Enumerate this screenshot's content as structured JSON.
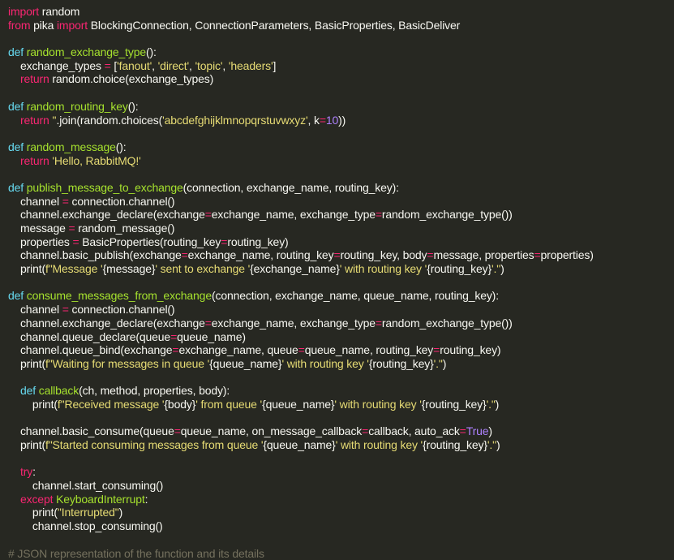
{
  "colors": {
    "background": "#272822",
    "plain": "#f8f8f2",
    "keyword": "#f92672",
    "def": "#66d9ef",
    "function": "#a6e22e",
    "string": "#e6db74",
    "number": "#ae81ff",
    "comment": "#75715e"
  },
  "code_lines": [
    [
      [
        "kw",
        "import"
      ],
      [
        "plain",
        " random"
      ]
    ],
    [
      [
        "kw",
        "from"
      ],
      [
        "plain",
        " pika "
      ],
      [
        "kw",
        "import"
      ],
      [
        "plain",
        " BlockingConnection, ConnectionParameters, BasicProperties, BasicDeliver"
      ]
    ],
    [],
    [
      [
        "def",
        "def"
      ],
      [
        "plain",
        " "
      ],
      [
        "fn",
        "random_exchange_type"
      ],
      [
        "plain",
        "():"
      ]
    ],
    [
      [
        "plain",
        "    exchange_types "
      ],
      [
        "op",
        "="
      ],
      [
        "plain",
        " ["
      ],
      [
        "str",
        "'fanout'"
      ],
      [
        "plain",
        ", "
      ],
      [
        "str",
        "'direct'"
      ],
      [
        "plain",
        ", "
      ],
      [
        "str",
        "'topic'"
      ],
      [
        "plain",
        ", "
      ],
      [
        "str",
        "'headers'"
      ],
      [
        "plain",
        "]"
      ]
    ],
    [
      [
        "plain",
        "    "
      ],
      [
        "kw",
        "return"
      ],
      [
        "plain",
        " random.choice(exchange_types)"
      ]
    ],
    [],
    [
      [
        "def",
        "def"
      ],
      [
        "plain",
        " "
      ],
      [
        "fn",
        "random_routing_key"
      ],
      [
        "plain",
        "():"
      ]
    ],
    [
      [
        "plain",
        "    "
      ],
      [
        "kw",
        "return"
      ],
      [
        "plain",
        " "
      ],
      [
        "str",
        "''"
      ],
      [
        "plain",
        ".join(random.choices("
      ],
      [
        "str",
        "'abcdefghijklmnopqrstuvwxyz'"
      ],
      [
        "plain",
        ", k"
      ],
      [
        "op",
        "="
      ],
      [
        "num",
        "10"
      ],
      [
        "plain",
        "))"
      ]
    ],
    [],
    [
      [
        "def",
        "def"
      ],
      [
        "plain",
        " "
      ],
      [
        "fn",
        "random_message"
      ],
      [
        "plain",
        "():"
      ]
    ],
    [
      [
        "plain",
        "    "
      ],
      [
        "kw",
        "return"
      ],
      [
        "plain",
        " "
      ],
      [
        "str",
        "'Hello, RabbitMQ!'"
      ]
    ],
    [],
    [
      [
        "def",
        "def"
      ],
      [
        "plain",
        " "
      ],
      [
        "fn",
        "publish_message_to_exchange"
      ],
      [
        "plain",
        "(connection, exchange_name, routing_key):"
      ]
    ],
    [
      [
        "plain",
        "    channel "
      ],
      [
        "op",
        "="
      ],
      [
        "plain",
        " connection.channel()"
      ]
    ],
    [
      [
        "plain",
        "    channel.exchange_declare(exchange"
      ],
      [
        "op",
        "="
      ],
      [
        "plain",
        "exchange_name, exchange_type"
      ],
      [
        "op",
        "="
      ],
      [
        "plain",
        "random_exchange_type())"
      ]
    ],
    [
      [
        "plain",
        "    message "
      ],
      [
        "op",
        "="
      ],
      [
        "plain",
        " random_message()"
      ]
    ],
    [
      [
        "plain",
        "    properties "
      ],
      [
        "op",
        "="
      ],
      [
        "plain",
        " BasicProperties(routing_key"
      ],
      [
        "op",
        "="
      ],
      [
        "plain",
        "routing_key)"
      ]
    ],
    [
      [
        "plain",
        "    channel.basic_publish(exchange"
      ],
      [
        "op",
        "="
      ],
      [
        "plain",
        "exchange_name, routing_key"
      ],
      [
        "op",
        "="
      ],
      [
        "plain",
        "routing_key, body"
      ],
      [
        "op",
        "="
      ],
      [
        "plain",
        "message, properties"
      ],
      [
        "op",
        "="
      ],
      [
        "plain",
        "properties)"
      ]
    ],
    [
      [
        "plain",
        "    print("
      ],
      [
        "str",
        "f\"Message '"
      ],
      [
        "plain",
        "{message}"
      ],
      [
        "str",
        "' sent to exchange '"
      ],
      [
        "plain",
        "{exchange_name}"
      ],
      [
        "str",
        "' with routing key '"
      ],
      [
        "plain",
        "{routing_key}"
      ],
      [
        "str",
        "'.\""
      ],
      [
        "plain",
        ")"
      ]
    ],
    [],
    [
      [
        "def",
        "def"
      ],
      [
        "plain",
        " "
      ],
      [
        "fn",
        "consume_messages_from_exchange"
      ],
      [
        "plain",
        "(connection, exchange_name, queue_name, routing_key):"
      ]
    ],
    [
      [
        "plain",
        "    channel "
      ],
      [
        "op",
        "="
      ],
      [
        "plain",
        " connection.channel()"
      ]
    ],
    [
      [
        "plain",
        "    channel.exchange_declare(exchange"
      ],
      [
        "op",
        "="
      ],
      [
        "plain",
        "exchange_name, exchange_type"
      ],
      [
        "op",
        "="
      ],
      [
        "plain",
        "random_exchange_type())"
      ]
    ],
    [
      [
        "plain",
        "    channel.queue_declare(queue"
      ],
      [
        "op",
        "="
      ],
      [
        "plain",
        "queue_name)"
      ]
    ],
    [
      [
        "plain",
        "    channel.queue_bind(exchange"
      ],
      [
        "op",
        "="
      ],
      [
        "plain",
        "exchange_name, queue"
      ],
      [
        "op",
        "="
      ],
      [
        "plain",
        "queue_name, routing_key"
      ],
      [
        "op",
        "="
      ],
      [
        "plain",
        "routing_key)"
      ]
    ],
    [
      [
        "plain",
        "    print("
      ],
      [
        "str",
        "f\"Waiting for messages in queue '"
      ],
      [
        "plain",
        "{queue_name}"
      ],
      [
        "str",
        "' with routing key '"
      ],
      [
        "plain",
        "{routing_key}"
      ],
      [
        "str",
        "'.\""
      ],
      [
        "plain",
        ")"
      ]
    ],
    [],
    [
      [
        "plain",
        "    "
      ],
      [
        "def",
        "def"
      ],
      [
        "plain",
        " "
      ],
      [
        "fn",
        "callback"
      ],
      [
        "plain",
        "(ch, method, properties, body):"
      ]
    ],
    [
      [
        "plain",
        "        print("
      ],
      [
        "str",
        "f\"Received message '"
      ],
      [
        "plain",
        "{body}"
      ],
      [
        "str",
        "' from queue '"
      ],
      [
        "plain",
        "{queue_name}"
      ],
      [
        "str",
        "' with routing key '"
      ],
      [
        "plain",
        "{routing_key}"
      ],
      [
        "str",
        "'.\""
      ],
      [
        "plain",
        ")"
      ]
    ],
    [],
    [
      [
        "plain",
        "    channel.basic_consume(queue"
      ],
      [
        "op",
        "="
      ],
      [
        "plain",
        "queue_name, on_message_callback"
      ],
      [
        "op",
        "="
      ],
      [
        "plain",
        "callback, auto_ack"
      ],
      [
        "op",
        "="
      ],
      [
        "const",
        "True"
      ],
      [
        "plain",
        ")"
      ]
    ],
    [
      [
        "plain",
        "    print("
      ],
      [
        "str",
        "f\"Started consuming messages from queue '"
      ],
      [
        "plain",
        "{queue_name}"
      ],
      [
        "str",
        "' with routing key '"
      ],
      [
        "plain",
        "{routing_key}"
      ],
      [
        "str",
        "'.\""
      ],
      [
        "plain",
        ")"
      ]
    ],
    [],
    [
      [
        "plain",
        "    "
      ],
      [
        "kw",
        "try"
      ],
      [
        "plain",
        ":"
      ]
    ],
    [
      [
        "plain",
        "        channel.start_consuming()"
      ]
    ],
    [
      [
        "plain",
        "    "
      ],
      [
        "kw",
        "except"
      ],
      [
        "plain",
        " "
      ],
      [
        "fn",
        "KeyboardInterrupt"
      ],
      [
        "plain",
        ":"
      ]
    ],
    [
      [
        "plain",
        "        print("
      ],
      [
        "str",
        "\"Interrupted\""
      ],
      [
        "plain",
        ")"
      ]
    ],
    [
      [
        "plain",
        "        channel.stop_consuming()"
      ]
    ],
    [],
    [
      [
        "cmt",
        "# JSON representation of the function and its details"
      ]
    ]
  ]
}
